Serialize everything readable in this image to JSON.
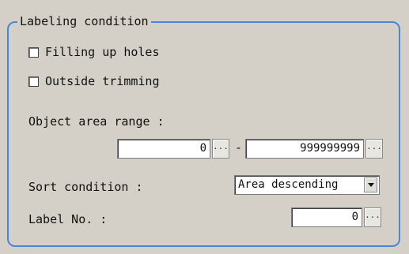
{
  "group": {
    "title": "Labeling condition"
  },
  "options": {
    "filling_up_holes": {
      "label": "Filling up holes",
      "checked": false
    },
    "outside_trimming": {
      "label": "Outside trimming",
      "checked": false
    }
  },
  "object_area": {
    "label": "Object area range :",
    "min_value": "0",
    "separator": "-",
    "max_value": "999999999",
    "browse_label": "..."
  },
  "sort": {
    "label": "Sort condition :",
    "selected": "Area descending"
  },
  "label_no": {
    "label": "Label No. :",
    "value": "0",
    "browse_label": "..."
  },
  "icons": {
    "dropdown": "chevron-down-icon",
    "checkbox": "checkbox-icon"
  }
}
